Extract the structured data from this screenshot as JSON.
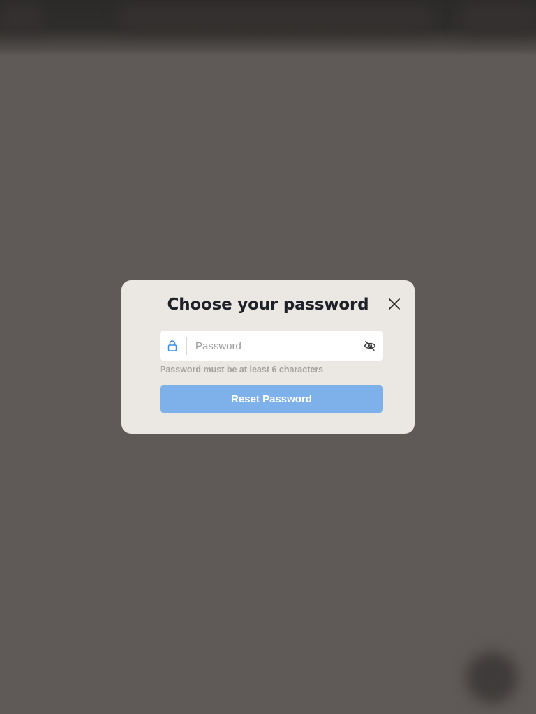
{
  "modal": {
    "title": "Choose your password",
    "close_icon": "close-icon",
    "password": {
      "placeholder": "Password",
      "value": "",
      "lock_icon": "lock-icon",
      "visibility_icon": "eye-off-icon"
    },
    "hint": "Password must be at least 6 characters",
    "submit_label": "Reset Password"
  },
  "colors": {
    "overlay": "#5f5a58",
    "modal_background": "#ebe7e2",
    "button_disabled": "#7eb0ea",
    "lock_icon": "#3a8ee6"
  }
}
